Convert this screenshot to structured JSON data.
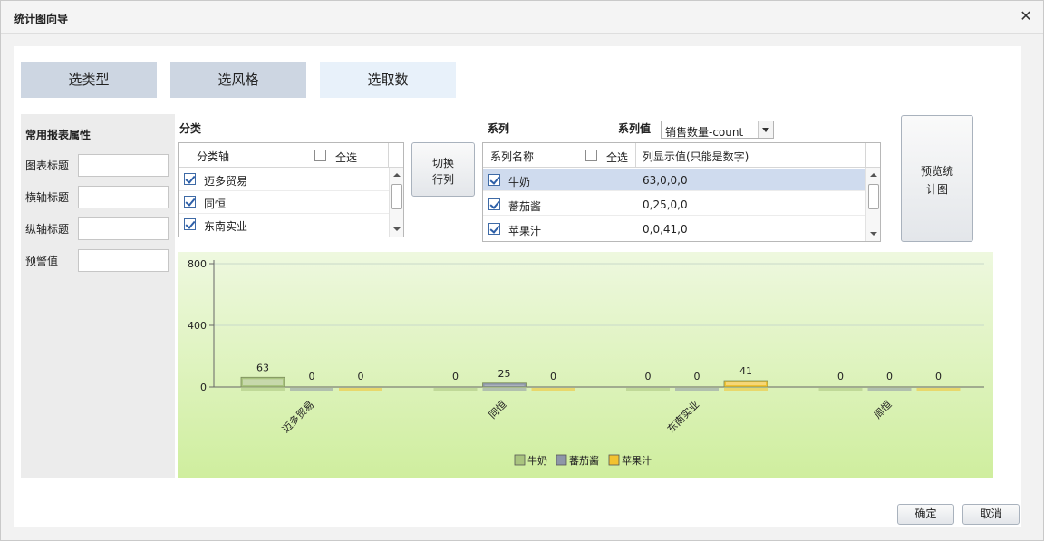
{
  "dialog": {
    "title": "统计图向导"
  },
  "steps": [
    {
      "label": "选类型",
      "state": "done"
    },
    {
      "label": "选风格",
      "state": "done"
    },
    {
      "label": "选取数",
      "state": "active"
    }
  ],
  "props": {
    "header": "常用报表属性",
    "fields": [
      {
        "label": "图表标题",
        "value": ""
      },
      {
        "label": "横轴标题",
        "value": ""
      },
      {
        "label": "纵轴标题",
        "value": ""
      },
      {
        "label": "预警值",
        "value": ""
      }
    ]
  },
  "category": {
    "section_label": "分类",
    "column_header": "分类轴",
    "select_all_label": "全选",
    "items": [
      {
        "label": "迈多贸易",
        "checked": true
      },
      {
        "label": "同恒",
        "checked": true
      },
      {
        "label": "东南实业",
        "checked": true
      }
    ]
  },
  "switch_button": {
    "line1": "切换",
    "line2": "行列"
  },
  "series": {
    "section_label": "系列",
    "value_label": "系列值",
    "value_select": "销售数量-count",
    "name_header": "系列名称",
    "select_all_label": "全选",
    "value_header": "列显示值(只能是数字)",
    "items": [
      {
        "name": "牛奶",
        "value": "63,0,0,0",
        "checked": true,
        "selected": true
      },
      {
        "name": "蕃茄酱",
        "value": "0,25,0,0",
        "checked": true,
        "selected": false
      },
      {
        "name": "苹果汁",
        "value": "0,0,41,0",
        "checked": true,
        "selected": false
      }
    ]
  },
  "preview_button": {
    "line1": "预览统",
    "line2": "计图"
  },
  "footer": {
    "ok": "确定",
    "cancel": "取消"
  },
  "chart_data": {
    "type": "bar",
    "categories": [
      "迈多贸易",
      "同恒",
      "东南实业",
      "周恒"
    ],
    "series": [
      {
        "name": "牛奶",
        "values": [
          63,
          0,
          0,
          0
        ],
        "color": "#a9c47f"
      },
      {
        "name": "蕃茄酱",
        "values": [
          0,
          25,
          0,
          0
        ],
        "color": "#8e97a8"
      },
      {
        "name": "苹果汁",
        "values": [
          0,
          0,
          41,
          0
        ],
        "color": "#f2c230"
      }
    ],
    "yticks": [
      0,
      400,
      800
    ],
    "ylim": [
      0,
      800
    ],
    "grid": true,
    "legend": "bottom"
  }
}
